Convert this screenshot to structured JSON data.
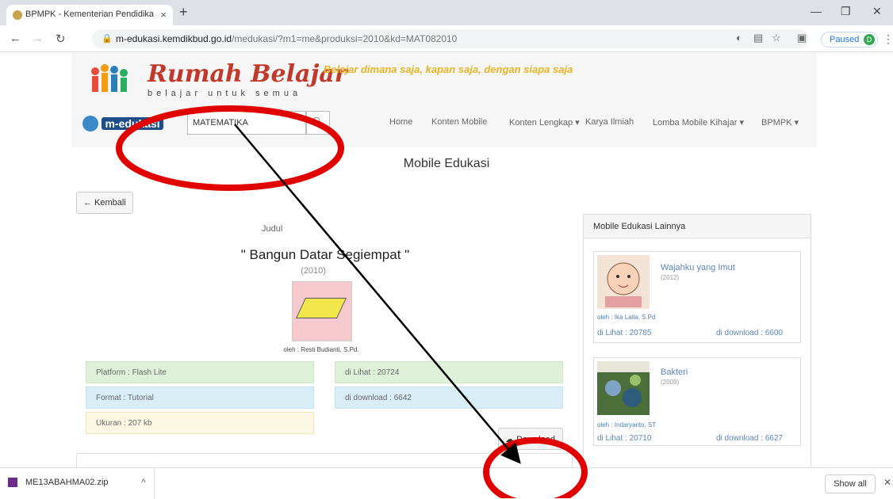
{
  "browser": {
    "tab_title": "BPMPK - Kementerian Pendidika",
    "tab_close": "×",
    "new_tab": "+",
    "url_host": "m-edukasi.kemdikbud.go.id",
    "url_path": "/medukasi/?m1=me&produksi=2010&kd=MAT082010",
    "profile_status": "Paused",
    "profile_initial": "D"
  },
  "header": {
    "logo_title": "Rumah Belajar",
    "logo_subtitle": "belajar untuk semua",
    "tagline": "Belajar dimana saja, kapan saja, dengan siapa saja",
    "medukasi_label": "m-edukasi",
    "search_value": "MATEMATIKA",
    "menu": [
      "Home",
      "Konten Mobile",
      "Konten Lengkap ▾",
      "Karya Ilmiah",
      "Lomba Mobile Kihajar ▾",
      "BPMPK ▾"
    ]
  },
  "page": {
    "title": "Mobile Edukasi",
    "back_label": "← Kembali",
    "judul_label": "Judul",
    "item_title": "\" Bangun Datar Segiempat \"",
    "item_year": "(2010)",
    "item_author": "oleh : Resti Budianti, S.Pd.",
    "platform": "Platform : Flash Lite",
    "format": "Format : Tutorial",
    "ukuran": "Ukuran : 207 kb",
    "dilihat": "di Lihat : 20724",
    "didownload": "di download : 6642",
    "download_label": "Download"
  },
  "sidebar": {
    "heading": "Mobile Edukasi Lainnya",
    "cards": [
      {
        "title": "Wajahku yang Imut",
        "year": "(2012)",
        "by": "oleh : Ika Laila, S.Pd",
        "views": "di Lihat : 20785",
        "downloads": "di download : 6600"
      },
      {
        "title": "Bakteri",
        "year": "(2009)",
        "by": "oleh : Indaryanto, ST",
        "views": "di Lihat : 20710",
        "downloads": "di download : 6627"
      }
    ]
  },
  "download_bar": {
    "file_name": "ME13ABAHMA02.zip",
    "show_all": "Show all"
  }
}
